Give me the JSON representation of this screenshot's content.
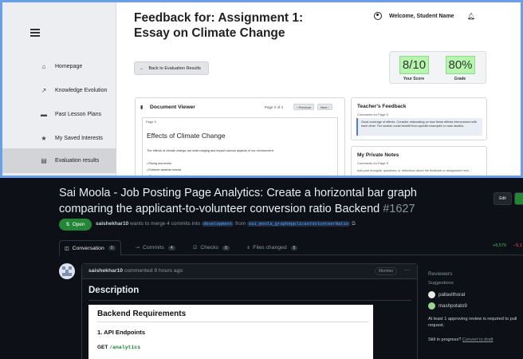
{
  "top": {
    "title_line1": "Feedback for: Assignment 1:",
    "title_line2": "Essay on Climate Change",
    "user": "Welcome, Student Name",
    "sidebar": [
      {
        "label": "Homepage",
        "icon": "home-icon",
        "glyph": "⌂"
      },
      {
        "label": "Knowledge Evolution",
        "icon": "trend-icon",
        "glyph": "↗"
      },
      {
        "label": "Past Lesson Plans",
        "icon": "folder-icon",
        "glyph": "▬"
      },
      {
        "label": "My Saved Interests",
        "icon": "star-icon",
        "glyph": "★"
      },
      {
        "label": "Evaluation results",
        "icon": "doc-icon",
        "glyph": "▤"
      }
    ],
    "back_label": "Back to Evaluation Results",
    "score": {
      "value": "8/10",
      "label": "Your Score"
    },
    "grade": {
      "value": "80%",
      "label": "Grade"
    },
    "doc_viewer": {
      "title": "Document Viewer",
      "page_info": "Page 2 of 4",
      "prev": "‹ Previous",
      "next": "Next ›",
      "page_label": "Page 5",
      "heading": "Effects of Climate Change",
      "para": "The effects of climate change are wide-ranging and impact various aspects of our environment:",
      "items": [
        "• Rising sea levels",
        "• Extreme weather events",
        "• Changes in precipitation patterns"
      ]
    },
    "feedback": {
      "title": "Teacher's Feedback",
      "sub": "Comments for Page 5",
      "text": "Good coverage of effects. Consider elaborating on how these effects interconnect with each other. The section could benefit from specific examples or case studies."
    },
    "notes": {
      "title": "My Private Notes",
      "sub": "Comments for Page 5",
      "text": "Add your thoughts, questions, or reflections about the feedback or assignment here..."
    }
  },
  "pr": {
    "title": "Sai Moola - Job Posting Page Analytics: Create a horizontal bar graph comparing the applicant-to-volunteer conversion ratio Backend",
    "number": "#1627",
    "edit": "Edit",
    "status": "Open",
    "author": "saishekhar10",
    "meta_mid": "wants to merge 4 commits into",
    "base": "development",
    "from": "from",
    "head": "sai_moola_graphApplicantVolunteerRatio",
    "tabs": [
      {
        "label": "Conversation",
        "count": "0",
        "icon": "comment-icon",
        "glyph": "◫"
      },
      {
        "label": "Commits",
        "count": "4",
        "icon": "commit-icon",
        "glyph": "⊸"
      },
      {
        "label": "Checks",
        "count": "0",
        "icon": "checks-icon",
        "glyph": "☑"
      },
      {
        "label": "Files changed",
        "count": "5",
        "icon": "files-icon",
        "glyph": "±"
      }
    ],
    "diff_add": "+8,579",
    "diff_del": "−5,1",
    "comment": {
      "author": "saishekhar10",
      "when": "commented 9 hours ago",
      "role": "Member",
      "menu": "···",
      "heading": "Description",
      "md_h2": "Backend Requirements",
      "md_h3": "1. API Endpoints",
      "md_get": "GET",
      "md_path": "/analytics"
    },
    "sidebar": {
      "reviewers": "Reviewers",
      "suggestions": "Suggestions",
      "rev1": "pallavithorat",
      "rev2": "mashpotato9",
      "note": "At least 1 approving review is required to pull request.",
      "progress": "Still in progress?",
      "draft": "Convert to draft"
    },
    "colors": {
      "open": "#238636",
      "add": "#3fb950",
      "del": "#f85149",
      "link": "#58a6ff"
    }
  }
}
